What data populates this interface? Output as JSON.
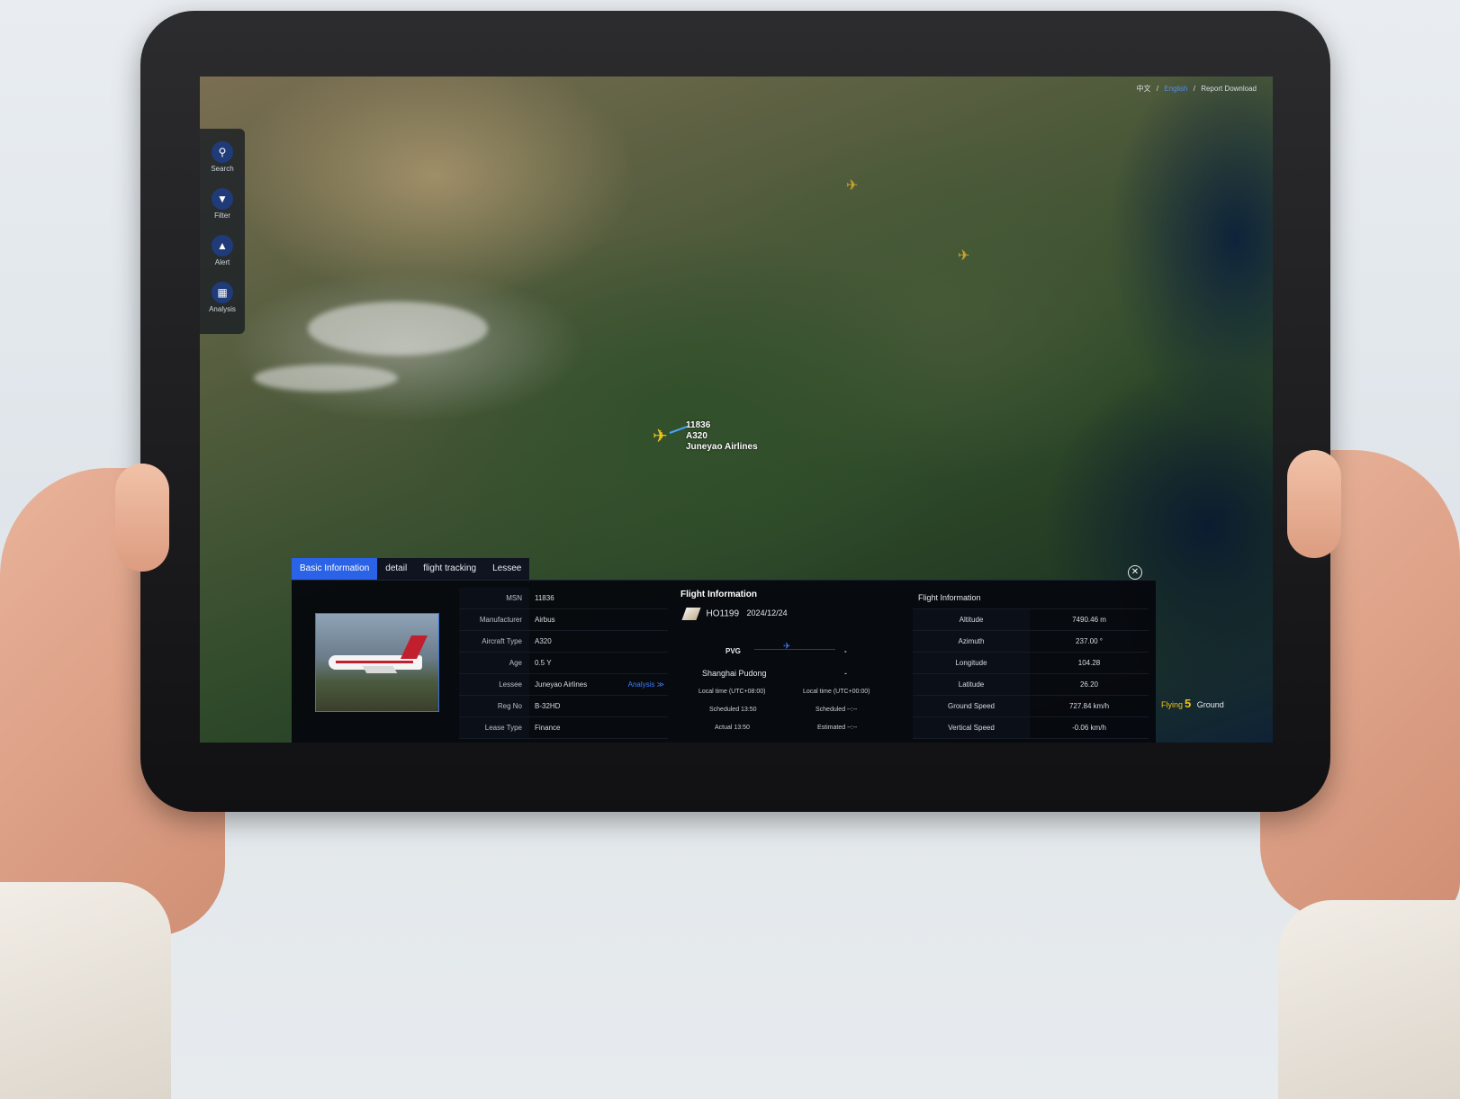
{
  "top_links": {
    "lang_cn": "中文",
    "lang_en": "English",
    "sep": "/",
    "report": "Report Download"
  },
  "sidebar": {
    "items": [
      {
        "label": "Search",
        "icon": "search-icon"
      },
      {
        "label": "Filter",
        "icon": "filter-icon"
      },
      {
        "label": "Alert",
        "icon": "alert-icon"
      },
      {
        "label": "Analysis",
        "icon": "analysis-icon"
      }
    ]
  },
  "map_flight_label": {
    "msn": "11836",
    "type": "A320",
    "airline": "Juneyao Airlines"
  },
  "tabs": [
    "Basic Information",
    "detail",
    "flight tracking",
    "Lessee"
  ],
  "basic_info": [
    {
      "key": "MSN",
      "value": "11836"
    },
    {
      "key": "Manufacturer",
      "value": "Airbus"
    },
    {
      "key": "Aircraft Type",
      "value": "A320"
    },
    {
      "key": "Age",
      "value": "0.5 Y"
    },
    {
      "key": "Lessee",
      "value": "Juneyao Airlines"
    },
    {
      "key": "Reg No",
      "value": "B-32HD"
    },
    {
      "key": "Lease Type",
      "value": "Finance"
    }
  ],
  "analysis_link": "Analysis ≫",
  "flight_info": {
    "title": "Flight Information",
    "flight_no": "HO1199",
    "date": "2024/12/24",
    "origin_code": "PVG",
    "dest_code": "-",
    "origin_name": "Shanghai Pudong",
    "dest_name": "-",
    "origin_local": "Local time (UTC+08:00)",
    "dest_local": "Local time (UTC+00:00)",
    "origin_sched": "Scheduled 13:50",
    "dest_sched": "Scheduled --:--",
    "origin_actual": "Actual 13:50",
    "dest_est": "Estimated --:--"
  },
  "metrics": {
    "title": "Flight Information",
    "rows": [
      {
        "key": "Altitude",
        "value": "7490.46 m"
      },
      {
        "key": "Azimuth",
        "value": "237.00 °"
      },
      {
        "key": "Longitude",
        "value": "104.28"
      },
      {
        "key": "Latitude",
        "value": "26.20"
      },
      {
        "key": "Ground Speed",
        "value": "727.84 km/h"
      },
      {
        "key": "Vertical Speed",
        "value": "-0.06 km/h"
      }
    ]
  },
  "status": {
    "flying_label": "Flying",
    "flying_count": "5",
    "ground_label": "Ground"
  },
  "colors": {
    "accent": "#2a63e8",
    "plane": "#f0c419",
    "panel_bg": "#06080e"
  }
}
